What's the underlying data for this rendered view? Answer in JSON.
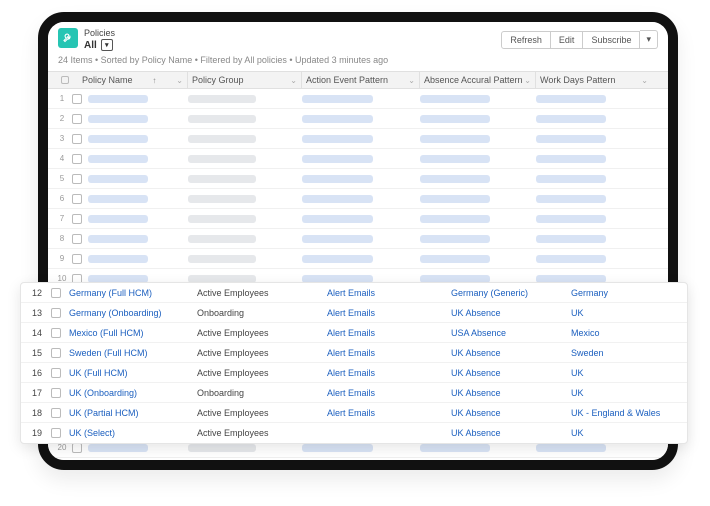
{
  "header": {
    "title": "Policies",
    "filter": "All",
    "buttons": {
      "refresh": "Refresh",
      "edit": "Edit",
      "subscribe": "Subscribe",
      "more": "▾"
    },
    "status": "24 Items • Sorted by Policy Name • Filtered by All policies • Updated 3 minutes ago"
  },
  "columns": {
    "name": "Policy Name",
    "group": "Policy Group",
    "action": "Action Event Pattern",
    "accrual": "Absence Accural Pattern",
    "workdays": "Work Days Pattern"
  },
  "placeholder_rows": [
    1,
    2,
    3,
    4,
    5,
    6,
    7,
    8,
    9,
    10
  ],
  "detail_rows": [
    {
      "n": 12,
      "name": "Germany (Full HCM)",
      "group": "Active Employees",
      "action": "Alert Emails",
      "accrual": "Germany (Generic)",
      "workdays": "Germany"
    },
    {
      "n": 13,
      "name": "Germany (Onboarding)",
      "group": "Onboarding",
      "action": "Alert Emails",
      "accrual": "UK Absence",
      "workdays": "UK"
    },
    {
      "n": 14,
      "name": "Mexico (Full HCM)",
      "group": "Active Employees",
      "action": "Alert Emails",
      "accrual": "USA Absence",
      "workdays": "Mexico"
    },
    {
      "n": 15,
      "name": "Sweden (Full HCM)",
      "group": "Active Employees",
      "action": "Alert Emails",
      "accrual": "UK Absence",
      "workdays": "Sweden"
    },
    {
      "n": 16,
      "name": "UK (Full HCM)",
      "group": "Active Employees",
      "action": "Alert Emails",
      "accrual": "UK Absence",
      "workdays": "UK"
    },
    {
      "n": 17,
      "name": "UK (Onboarding)",
      "group": "Onboarding",
      "action": "Alert Emails",
      "accrual": "UK Absence",
      "workdays": "UK"
    },
    {
      "n": 18,
      "name": "UK (Partial HCM)",
      "group": "Active Employees",
      "action": "Alert Emails",
      "accrual": "UK Absence",
      "workdays": "UK - England & Wales"
    },
    {
      "n": 19,
      "name": "UK (Select)",
      "group": "Active Employees",
      "action": "",
      "accrual": "UK Absence",
      "workdays": "UK"
    }
  ],
  "trailing_row": 20
}
